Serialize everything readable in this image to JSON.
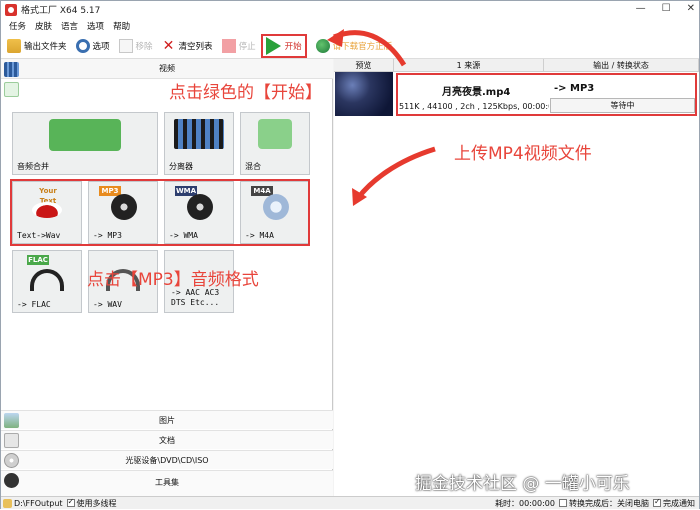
{
  "window": {
    "title": "格式工厂 X64 5.17",
    "controls": [
      "—",
      "☐",
      "✕"
    ]
  },
  "menu": [
    "任务",
    "皮肤",
    "语言",
    "选项",
    "帮助"
  ],
  "toolbar": {
    "output_folder": "输出文件夹",
    "options": "选项",
    "remove": "移除",
    "clear_list": "清空列表",
    "stop": "停止",
    "start": "开始",
    "help": "请下载官方正版"
  },
  "left": {
    "video_label": "视频",
    "tiles": [
      {
        "label": "音频合并"
      },
      {
        "label": "分离器"
      },
      {
        "label": "混合"
      },
      {
        "label": "Text->Wav",
        "tag": "Your Text"
      },
      {
        "label": "-> MP3",
        "tag": "MP3"
      },
      {
        "label": "-> WMA",
        "tag": "WMA"
      },
      {
        "label": "-> M4A",
        "tag": "M4A"
      },
      {
        "label": "-> FLAC",
        "tag": "FLAC"
      },
      {
        "label": "-> WAV"
      },
      {
        "label": "-> AAC AC3\nDTS Etc..."
      }
    ],
    "bottom_categories": [
      "图片",
      "文档",
      "光驱设备\\DVD\\CD\\ISO",
      "工具集"
    ]
  },
  "table": {
    "headers": [
      "预览",
      "1 来源",
      "输出 / 转换状态"
    ],
    "row": {
      "filename": "月亮夜景.mp4",
      "target": "-> MP3",
      "meta": "511K , 44100 , 2ch , 125Kbps, 00:00:00",
      "status": "等待中"
    }
  },
  "annotations": {
    "click_start": "点击绿色的【开始】",
    "upload": "上传MP4视频文件",
    "click_mp3": "点击【MP3】音频格式",
    "watermark": "掘金技术社区 @ 一罐小可乐"
  },
  "statusbar": {
    "output_path": "D:\\FFOutput",
    "multithread": "使用多线程",
    "elapsed": "耗时：00:00:00",
    "shutdown": "转换完成后：关闭电脑",
    "notify": "完成通知"
  },
  "colors": {
    "accent_red": "#e03a3a",
    "play_green": "#2aa13a"
  }
}
